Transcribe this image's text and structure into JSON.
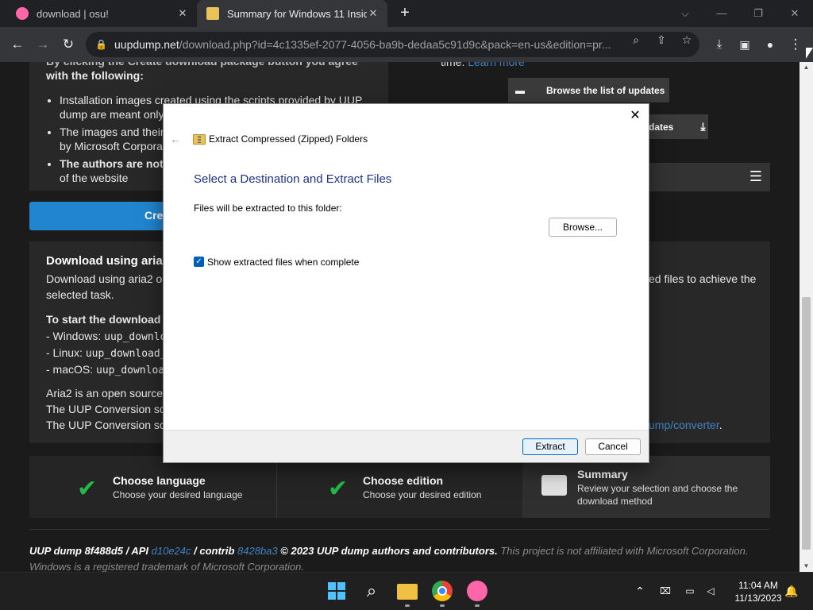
{
  "browser": {
    "tabs": [
      {
        "title": "download | osu!"
      },
      {
        "title": "Summary for Windows 11 Insider"
      }
    ],
    "url_host": "uupdump.net",
    "url_path": "/download.php?id=4c1335ef-2077-4056-ba9b-dedaa5c91d9c&pack=en-us&edition=pr..."
  },
  "page": {
    "agreement_heading_partial": "By clicking the Create download package button you agree",
    "agreement_heading": "with the following:",
    "bullets": [
      {
        "a": "Installation images created using the scripts provided by UUP",
        "b": "dump are meant only"
      },
      {
        "a": "The images and their",
        "b": "by Microsoft Corpora"
      },
      {
        "a": "The authors are not",
        "b": "of the website"
      }
    ],
    "create_button": "Cre",
    "right_top_text": "time.",
    "learn_more": "Learn more",
    "browse_updates": "Browse the list of updates",
    "updates_btn": "dates",
    "aria2_title": "Download using aria2",
    "aria2_desc": "Download using aria2 o",
    "aria2_desc_right": "ed files to achieve the",
    "aria2_desc2": "selected task.",
    "start_download": "To start the download p",
    "windows_line": "- Windows: ",
    "windows_cmd": "uup_downlo",
    "linux_line": "- Linux: ",
    "linux_cmd": "uup_download_",
    "macos_line": "- macOS: ",
    "macos_cmd": "uup_downloa",
    "aria2_open": "Aria2 is an open source p",
    "conv1": "The UUP Conversion scr",
    "conv2": "The UUP Conversion scr",
    "conv_link": "ump/converter",
    "conv_end": "."
  },
  "steps": [
    {
      "title": "Choose language",
      "desc": "Choose your desired language"
    },
    {
      "title": "Choose edition",
      "desc": "Choose your desired edition"
    },
    {
      "title": "Summary",
      "desc1": "Review your selection and choose the",
      "desc2": "download method"
    }
  ],
  "footer": {
    "part1": "UUP dump 8f488d5 / API ",
    "api_link": "d10e24c",
    "part2": " / contrib ",
    "contrib_link": "8428ba3",
    "part3": " © 2023 UUP dump authors and contributors.",
    "dim1": " This project is not affiliated with Microsoft Corporation.",
    "dim2": "Windows is a registered trademark of Microsoft Corporation."
  },
  "dialog": {
    "title": "Extract Compressed (Zipped) Folders",
    "heading": "Select a Destination and Extract Files",
    "folder_label": "Files will be extracted to this folder:",
    "browse": "Browse...",
    "checkbox_label": "Show extracted files when complete",
    "checkbox_checked": true,
    "extract": "Extract",
    "cancel": "Cancel"
  },
  "taskbar": {
    "time": "11:04 AM",
    "date": "11/13/2023"
  },
  "colors": {
    "accent_blue": "#2185d0",
    "check_green": "#21ba45",
    "osu_pink": "#ff66aa"
  }
}
